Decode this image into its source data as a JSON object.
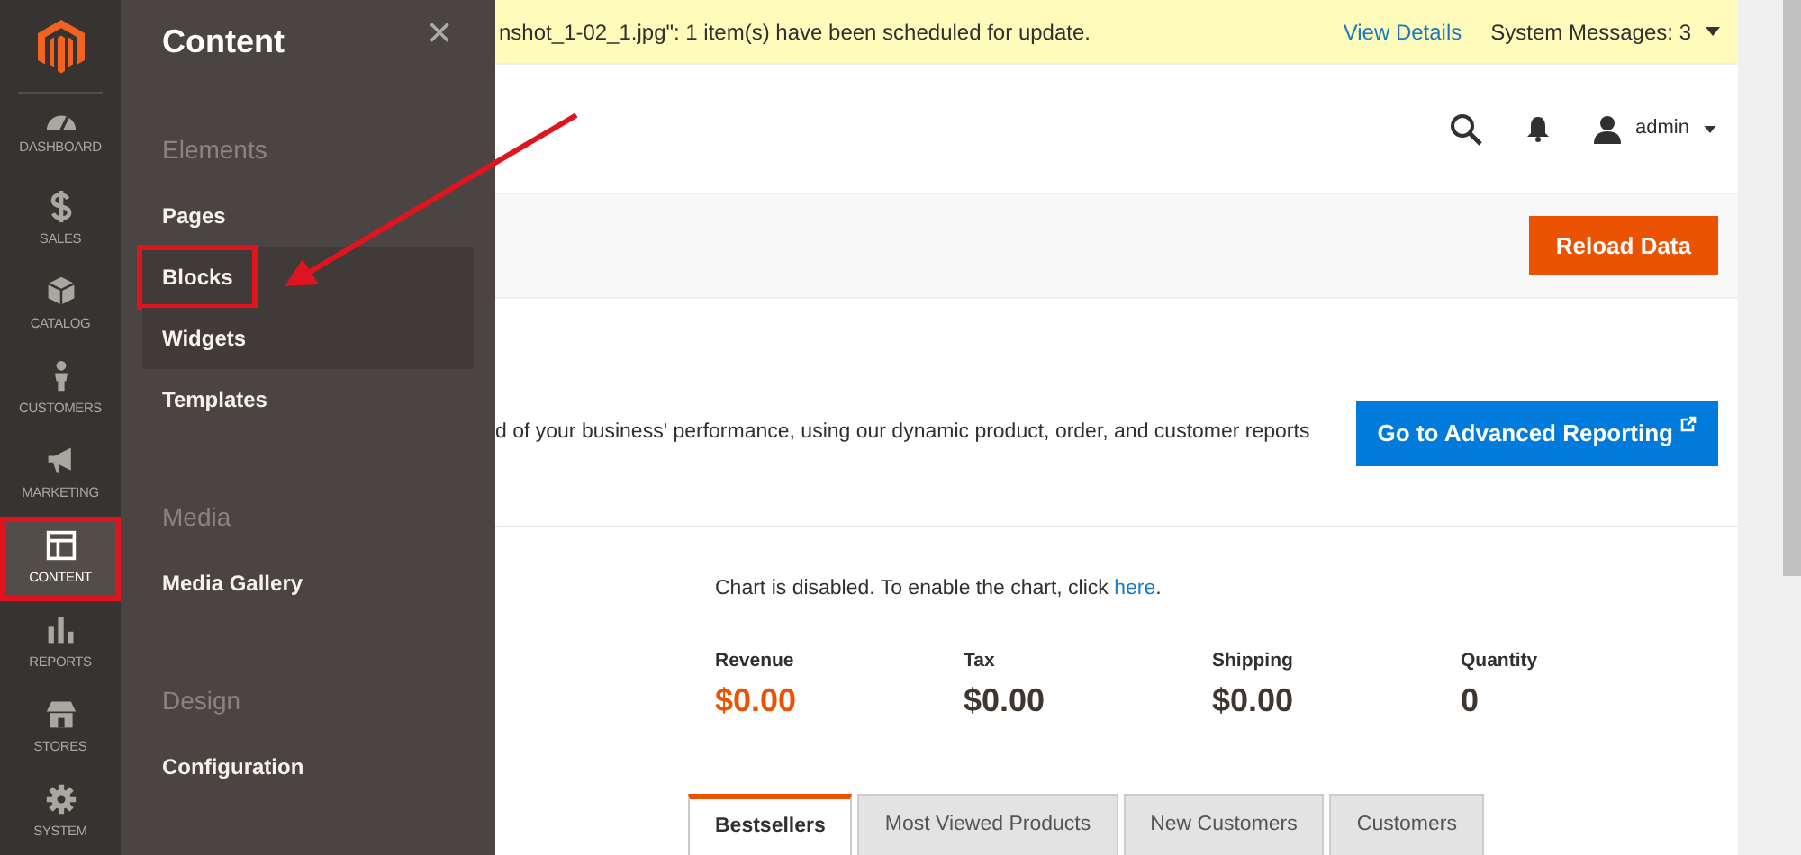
{
  "left_nav": {
    "items": [
      {
        "label": "DASHBOARD",
        "selected": false,
        "highlighted": false
      },
      {
        "label": "SALES",
        "selected": false,
        "highlighted": false
      },
      {
        "label": "CATALOG",
        "selected": false,
        "highlighted": false
      },
      {
        "label": "CUSTOMERS",
        "selected": false,
        "highlighted": false
      },
      {
        "label": "MARKETING",
        "selected": false,
        "highlighted": false
      },
      {
        "label": "CONTENT",
        "selected": true,
        "highlighted": true
      },
      {
        "label": "REPORTS",
        "selected": false,
        "highlighted": false
      },
      {
        "label": "STORES",
        "selected": false,
        "highlighted": false
      },
      {
        "label": "SYSTEM",
        "selected": false,
        "highlighted": false
      }
    ]
  },
  "flyout": {
    "title": "Content",
    "close": "×",
    "sections": [
      {
        "heading": "Elements",
        "items": [
          {
            "label": "Pages",
            "hovered": false,
            "highlighted": false
          },
          {
            "label": "Blocks",
            "hovered": true,
            "highlighted": true
          },
          {
            "label": "Widgets",
            "hovered": true,
            "highlighted": false
          },
          {
            "label": "Templates",
            "hovered": false,
            "highlighted": false
          }
        ]
      },
      {
        "heading": "Media",
        "items": [
          {
            "label": "Media Gallery",
            "hovered": false,
            "highlighted": false
          }
        ]
      },
      {
        "heading": "Design",
        "items": [
          {
            "label": "Configuration",
            "hovered": false,
            "highlighted": false
          }
        ]
      }
    ]
  },
  "message_bar": {
    "text": "nshot_1-02_1.jpg\": 1 item(s) have been scheduled for update.",
    "link": "View Details",
    "system_messages": "System Messages: 3"
  },
  "header": {
    "user": "admin"
  },
  "actions": {
    "button": "Reload Data"
  },
  "advanced_reporting": {
    "text": "d of your business' performance, using our dynamic product, order, and customer reports",
    "button": "Go to Advanced Reporting"
  },
  "chart_notice": {
    "text": "Chart is disabled. To enable the chart, click ",
    "link": "here",
    "end": "."
  },
  "stats": [
    {
      "label": "Revenue",
      "value": "$0.00",
      "accent": true
    },
    {
      "label": "Tax",
      "value": "$0.00",
      "accent": false
    },
    {
      "label": "Shipping",
      "value": "$0.00",
      "accent": false
    },
    {
      "label": "Quantity",
      "value": "0",
      "accent": false
    }
  ],
  "tabs": [
    {
      "label": "Bestsellers",
      "selected": true
    },
    {
      "label": "Most Viewed Products",
      "selected": false
    },
    {
      "label": "New Customers",
      "selected": false
    },
    {
      "label": "Customers",
      "selected": false
    }
  ]
}
